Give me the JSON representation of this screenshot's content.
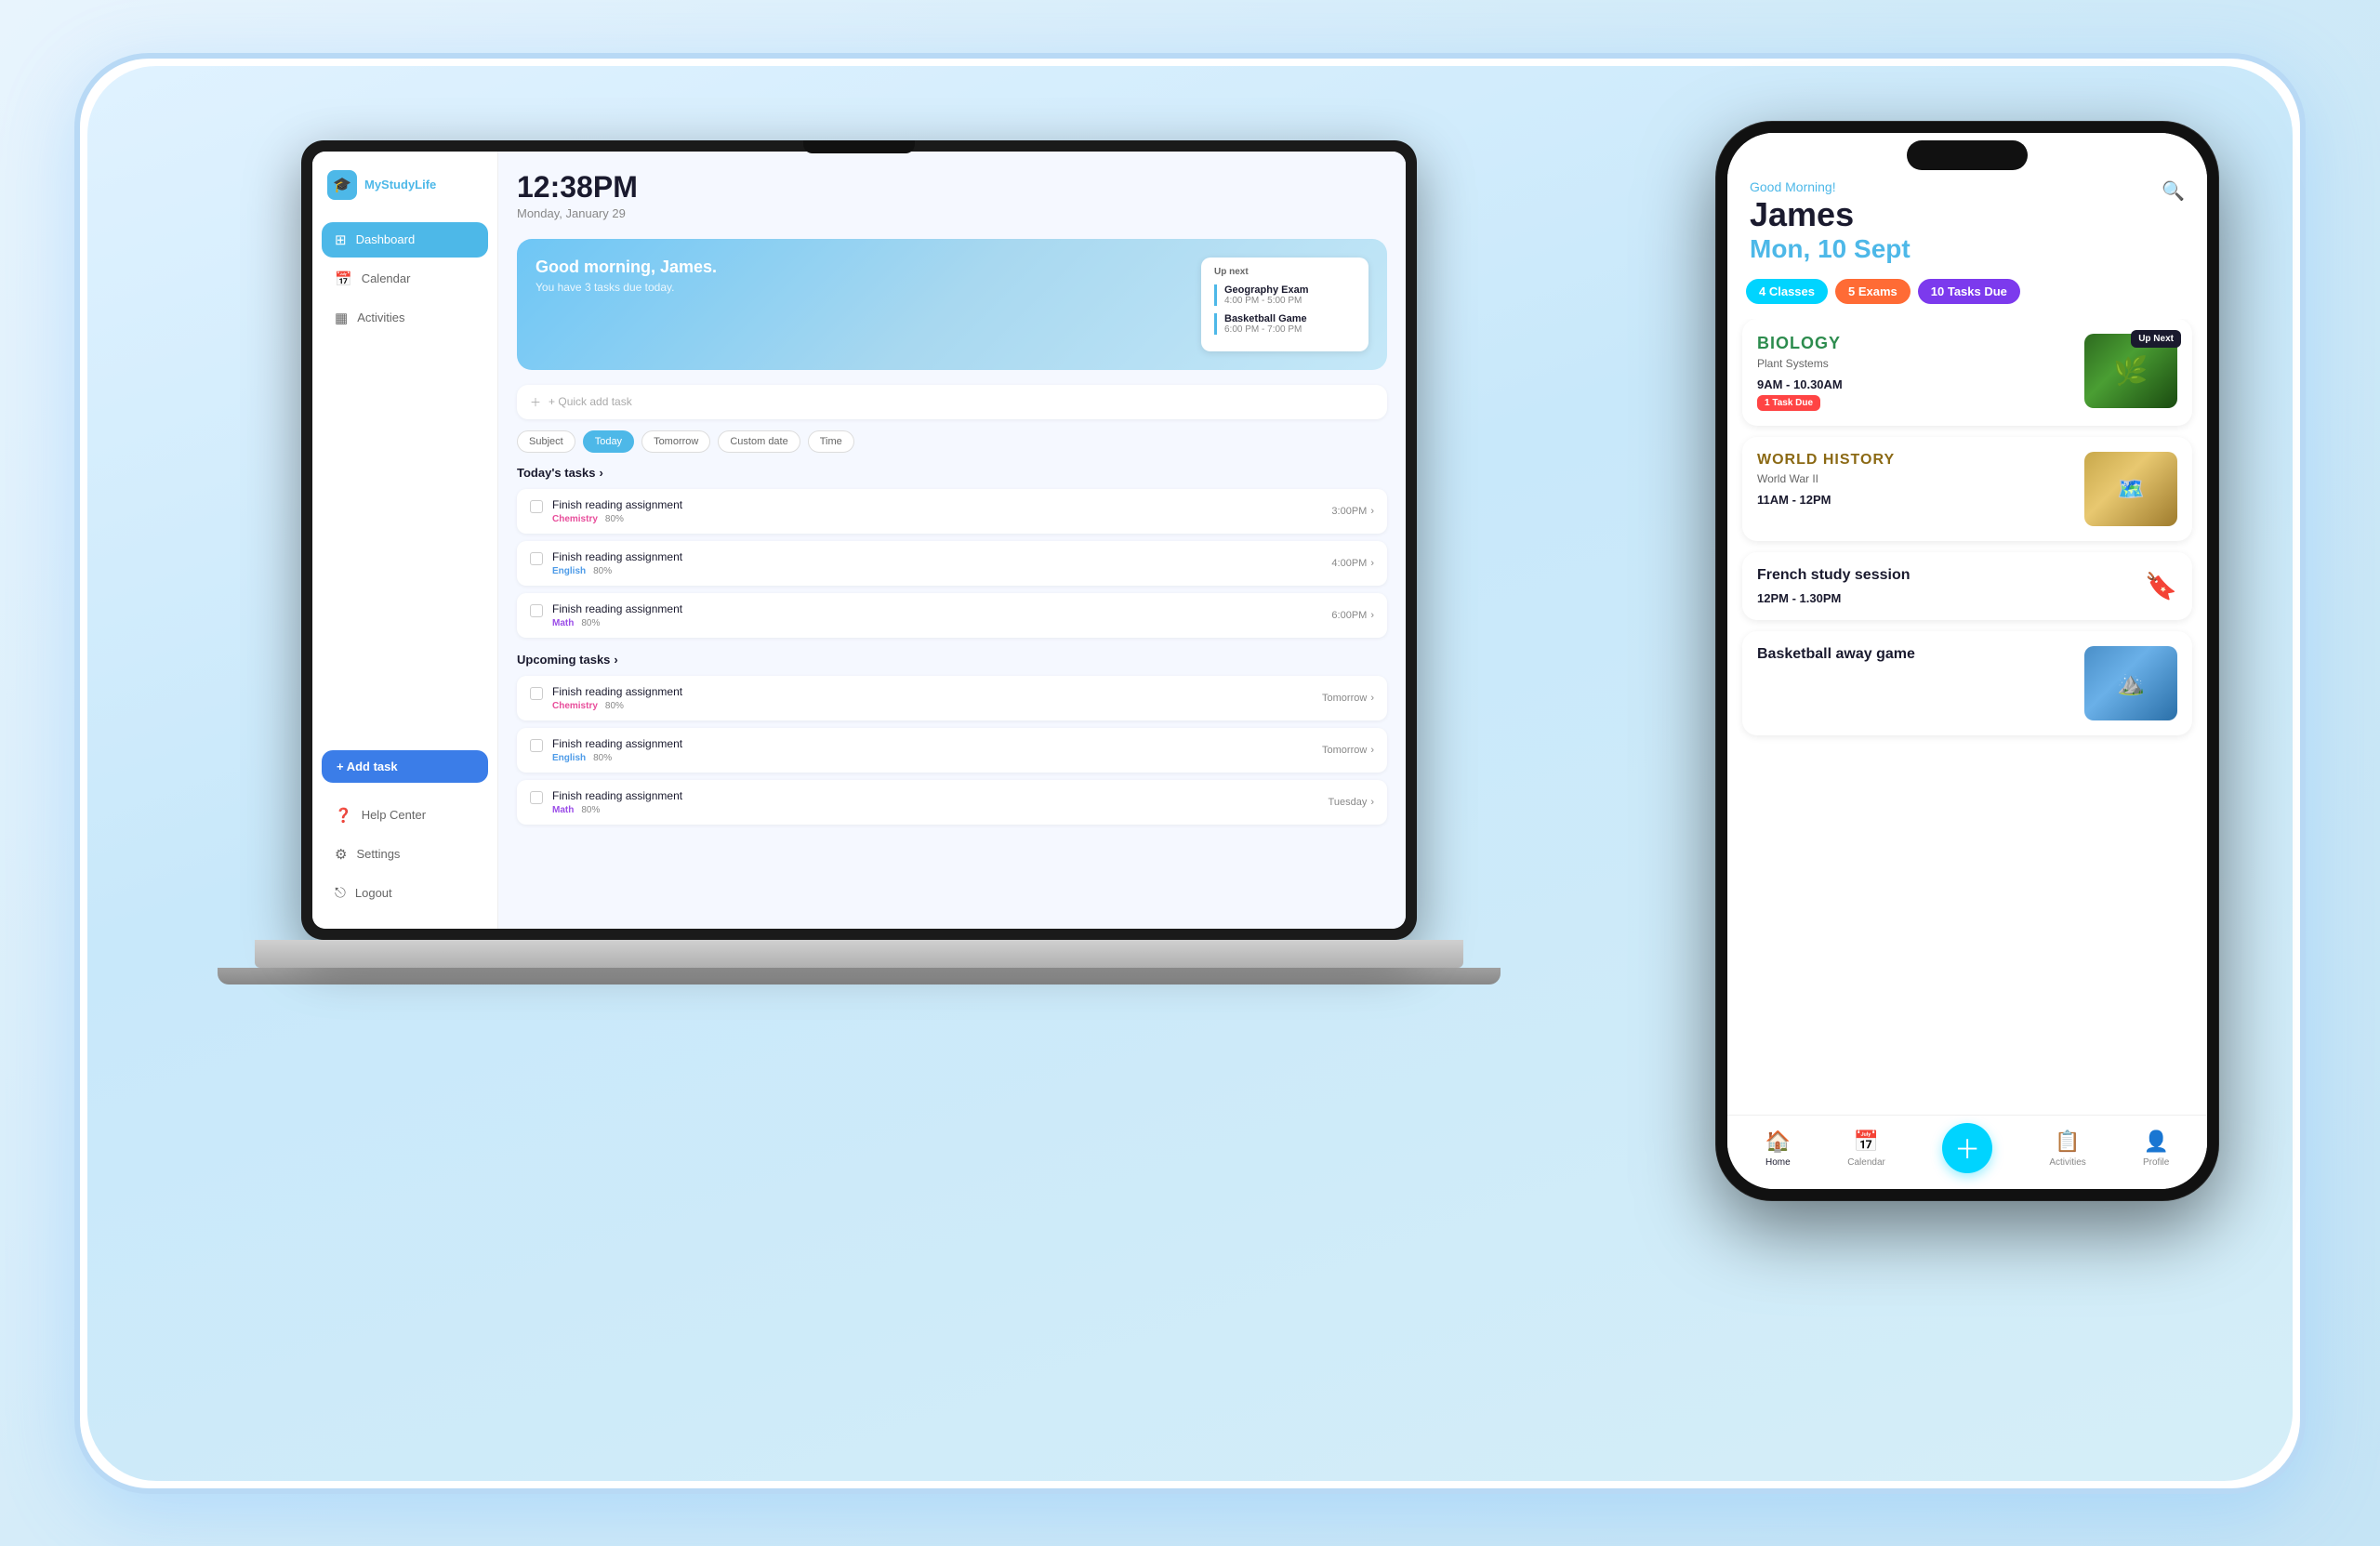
{
  "app": {
    "name": "MyStudyLife"
  },
  "laptop": {
    "time": "12:38PM",
    "date": "Monday, January 29",
    "welcome_title": "Good morning, James.",
    "welcome_subtitle": "You have 3 tasks due today.",
    "up_next_label": "Up next",
    "up_next_items": [
      {
        "name": "Geography Exam",
        "time": "4:00 PM - 5:00 PM"
      },
      {
        "name": "Basketball Game",
        "time": "6:00 PM - 7:00 PM"
      }
    ],
    "quick_add_placeholder": "+ Quick add task",
    "filters": [
      "Subject",
      "Today",
      "Tomorrow",
      "Custom date",
      "Time"
    ],
    "todays_tasks_label": "Today's tasks",
    "tasks": [
      {
        "name": "Finish reading assignment",
        "subject": "Chemistry",
        "subject_type": "chemistry",
        "progress": "80%",
        "time": "3:00PM"
      },
      {
        "name": "Finish reading assignment",
        "subject": "English",
        "subject_type": "english",
        "progress": "80%",
        "time": "4:00PM"
      },
      {
        "name": "Finish reading assignment",
        "subject": "Math",
        "subject_type": "math",
        "progress": "80%",
        "time": "6:00PM"
      }
    ],
    "upcoming_tasks_label": "Upcoming tasks",
    "upcoming_tasks": [
      {
        "name": "Finish reading assignment",
        "subject": "Chemistry",
        "subject_type": "chemistry",
        "progress": "80%",
        "when": "Tomorrow"
      },
      {
        "name": "Finish reading assignment",
        "subject": "English",
        "subject_type": "english",
        "progress": "80%",
        "when": "Tomorrow"
      },
      {
        "name": "Finish reading assignment",
        "subject": "Math",
        "subject_type": "math",
        "progress": "80%",
        "when": "Tuesday"
      }
    ],
    "nav": [
      {
        "label": "Dashboard",
        "active": true
      },
      {
        "label": "Calendar",
        "active": false
      },
      {
        "label": "Activities",
        "active": false
      }
    ],
    "add_task_label": "+ Add task",
    "help_label": "Help Center",
    "settings_label": "Settings",
    "logout_label": "Logout"
  },
  "phone": {
    "greeting": "Good Morning!",
    "name": "James",
    "date": "Mon, 10 Sept",
    "stats": [
      {
        "label": "4 Classes",
        "type": "classes"
      },
      {
        "label": "5 Exams",
        "type": "exams"
      },
      {
        "label": "10 Tasks Due",
        "type": "tasks"
      }
    ],
    "classes": [
      {
        "subject": "BIOLOGY",
        "subject_color": "biology",
        "topic": "Plant Systems",
        "time": "9AM - 10.30AM",
        "has_image": true,
        "image_type": "biology",
        "up_next": true,
        "task_due": "1 Task Due"
      },
      {
        "subject": "WORLD HISTORY",
        "subject_color": "history",
        "topic": "World War II",
        "time": "11AM - 12PM",
        "has_image": true,
        "image_type": "history",
        "up_next": false,
        "task_due": null
      },
      {
        "subject": "French study session",
        "subject_color": "french",
        "topic": "",
        "time": "12PM - 1.30PM",
        "has_image": false,
        "image_type": "bookmark",
        "up_next": false,
        "task_due": null
      },
      {
        "subject": "Basketball away game",
        "subject_color": "basketball",
        "topic": "",
        "time": "",
        "has_image": true,
        "image_type": "basketball",
        "up_next": false,
        "task_due": null
      }
    ],
    "nav": [
      {
        "label": "Home",
        "icon": "🏠",
        "active": true
      },
      {
        "label": "Calendar",
        "icon": "📅",
        "active": false
      },
      {
        "label": "+",
        "icon": "+",
        "active": false,
        "is_plus": true
      },
      {
        "label": "Activities",
        "icon": "📋",
        "active": false
      },
      {
        "label": "Profile",
        "icon": "👤",
        "active": false
      }
    ]
  }
}
